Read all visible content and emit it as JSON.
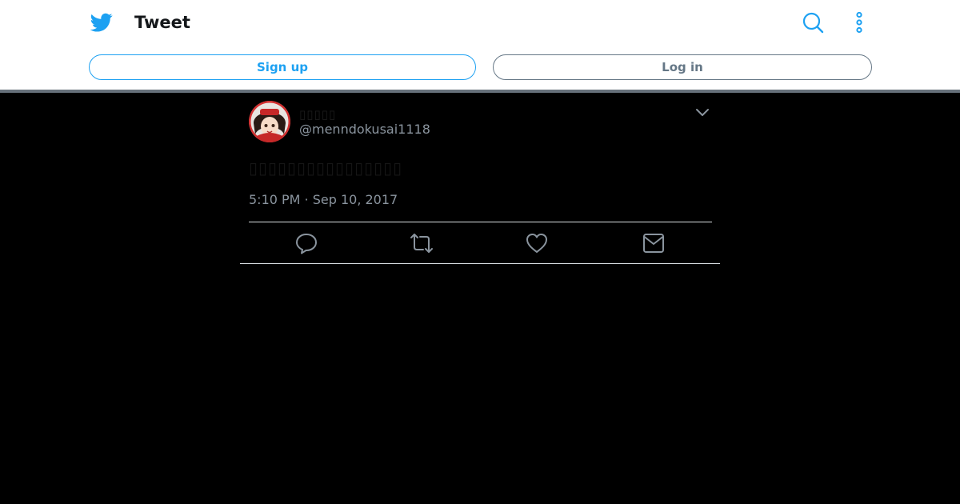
{
  "header": {
    "title": "Tweet",
    "signup_label": "Sign up",
    "login_label": "Log in",
    "icons": {
      "logo": "twitter-bird-icon",
      "search": "search-icon",
      "more": "more-vertical-icon"
    }
  },
  "tweet": {
    "display_name": "▯▯▯▯▯",
    "handle": "@menndokusai1118",
    "text": "▯▯▯▯▯▯▯▯▯▯▯▯▯▯▯▯",
    "timestamp": "5:10 PM · Sep 10, 2017",
    "actions": [
      "reply-icon",
      "retweet-icon",
      "like-icon",
      "direct-message-icon"
    ]
  },
  "colors": {
    "brand": "#1da1f2",
    "secondary_text": "#8a949e",
    "background": "#000000",
    "header_background": "#ffffff"
  }
}
